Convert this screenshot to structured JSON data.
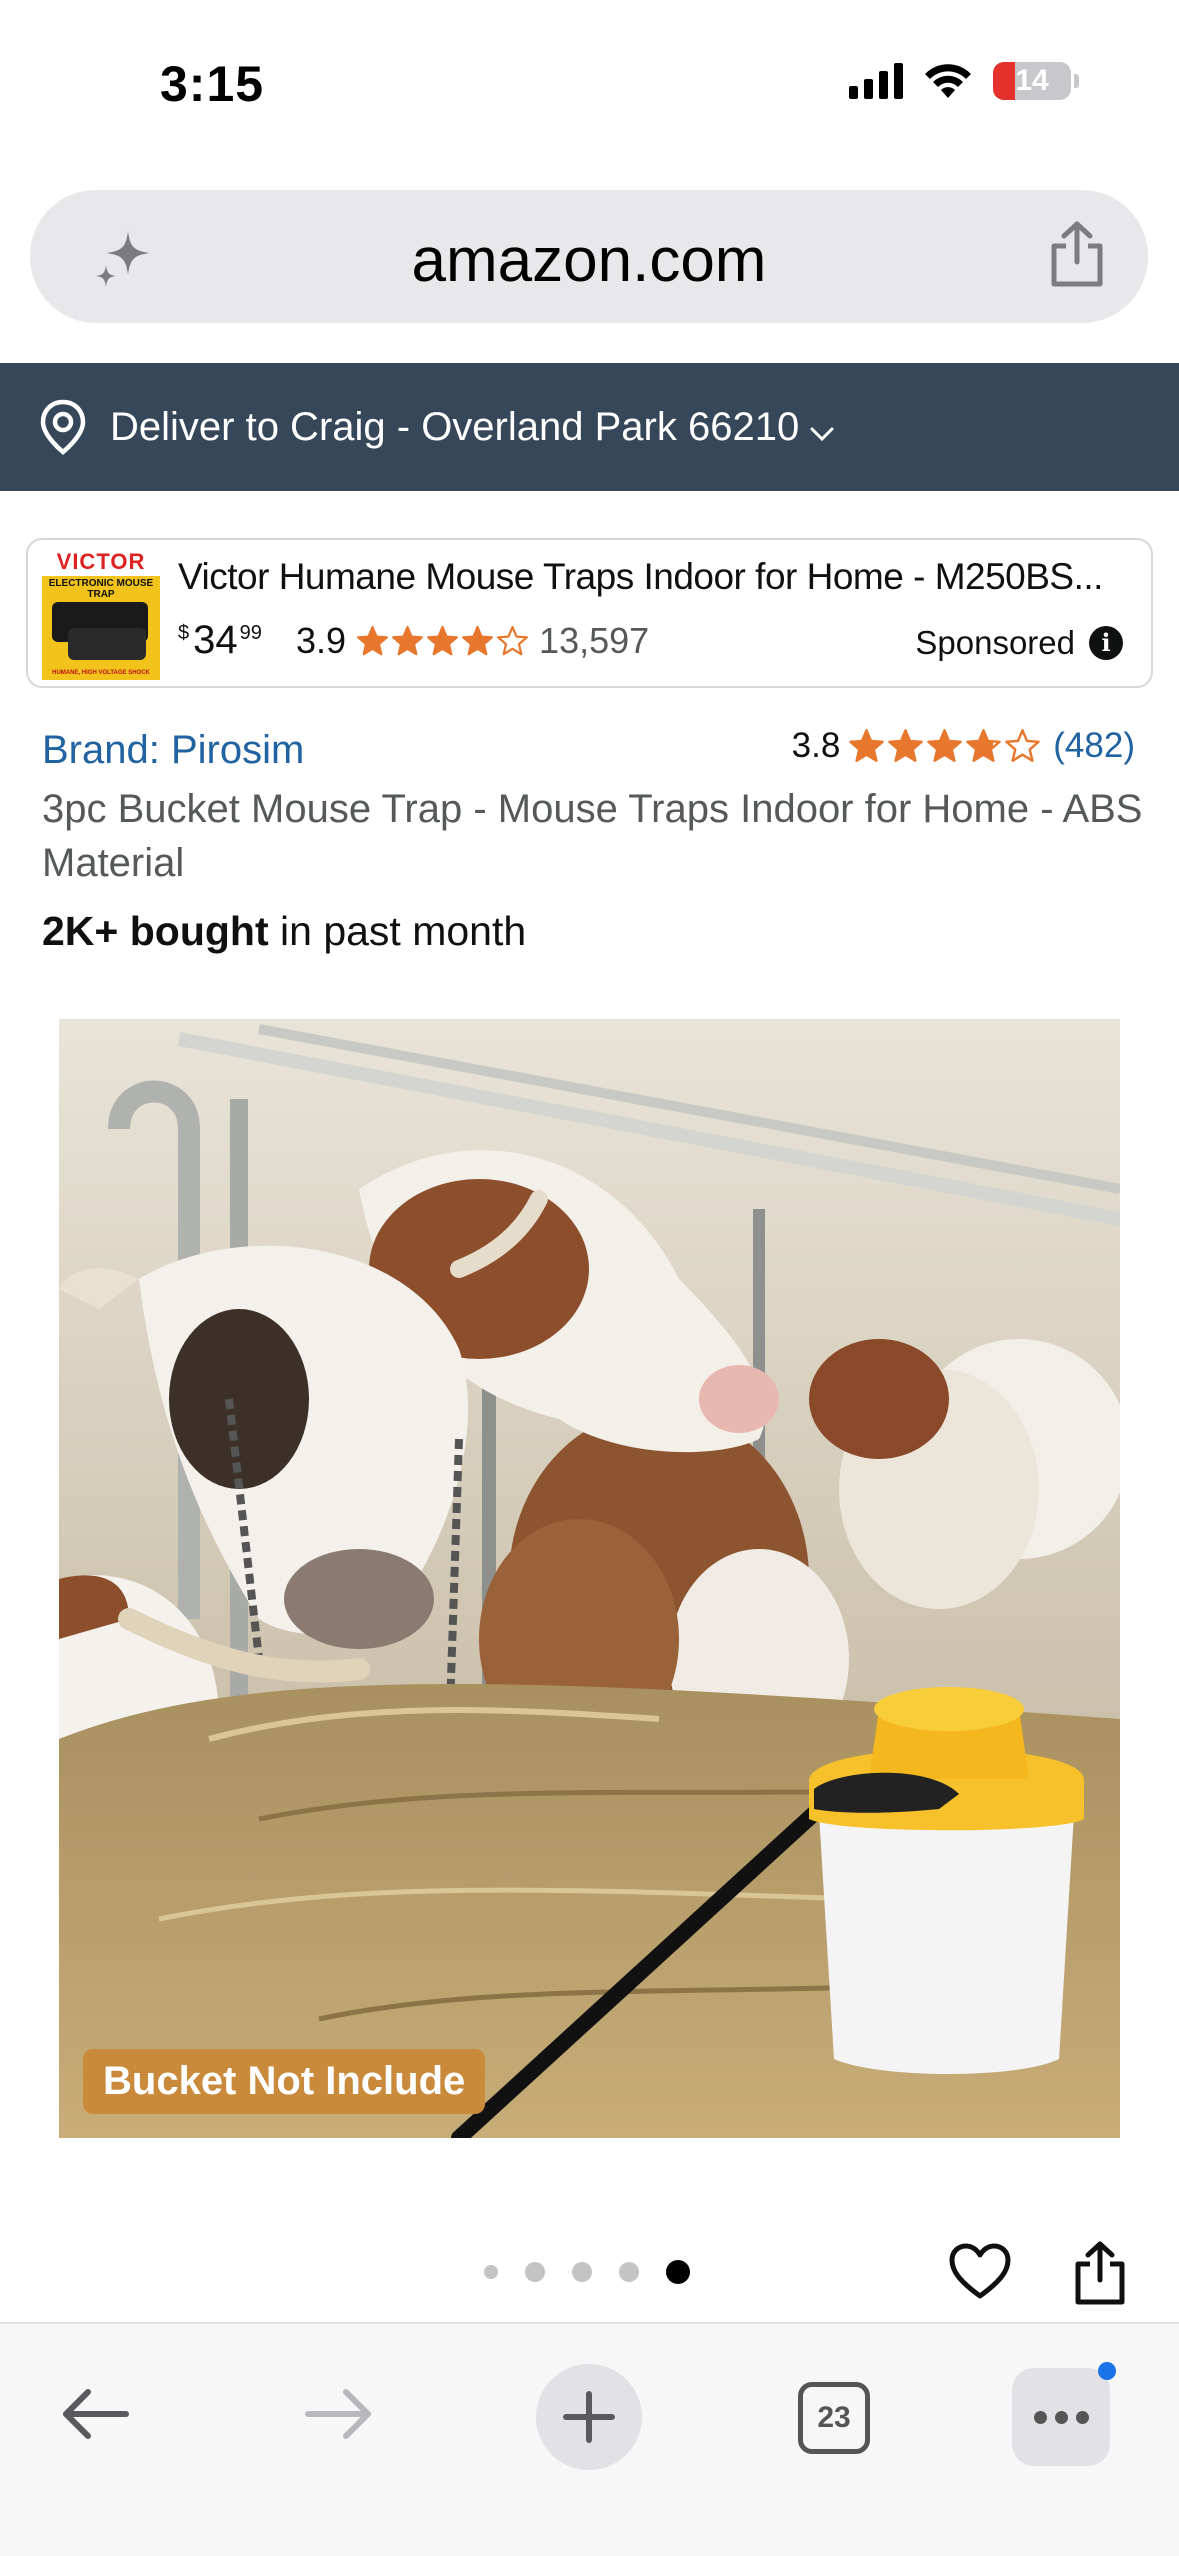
{
  "status_bar": {
    "time": "3:15",
    "battery": "14"
  },
  "browser": {
    "url": "amazon.com",
    "tab_count": "23"
  },
  "delivery": {
    "text": "Deliver to Craig - Overland Park 66210"
  },
  "sponsored": {
    "thumb_brand": "VICTOR",
    "thumb_sub": "ELECTRONIC MOUSE TRAP",
    "thumb_foot": "HUMANE, HIGH VOLTAGE SHOCK",
    "title": "Victor Humane Mouse Traps Indoor for Home - M250BS...",
    "price_symbol": "$",
    "price_whole": "34",
    "price_fraction": "99",
    "rating": "3.9",
    "stars": 3.9,
    "review_count": "13,597",
    "label": "Sponsored"
  },
  "product": {
    "brand": "Brand: Pirosim",
    "rating": "3.8",
    "stars": 3.8,
    "review_count": "(482)",
    "title": "3pc Bucket Mouse Trap - Mouse Traps Indoor for Home - ABS Material",
    "bought_bold": "2K+ bought",
    "bought_rest": " in past month",
    "image_badge": "Bucket Not Include"
  },
  "gallery": {
    "image_count": 5,
    "active_index": 4
  },
  "colors": {
    "delivery_bg": "#37475a",
    "link": "#2162a1",
    "star": "#e8772e",
    "active_dot": "#000000"
  },
  "icons": [
    "ai-sparkle-icon",
    "share-icon",
    "location-pin-icon",
    "chevron-down-icon",
    "info-icon",
    "heart-icon",
    "back-arrow-icon",
    "forward-arrow-icon",
    "plus-icon",
    "tabs-icon",
    "more-icon"
  ]
}
